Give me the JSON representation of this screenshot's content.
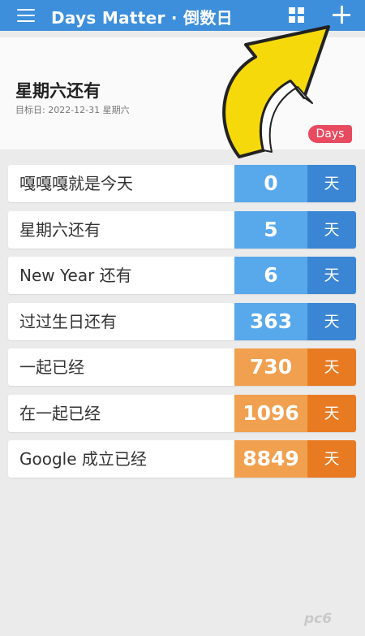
{
  "appbar": {
    "title": "Days Matter · 倒数日",
    "menu_icon": "hamburger-menu-icon",
    "grid_icon": "grid-view-icon",
    "add_icon": "plus-icon",
    "color": "#3d8fdc"
  },
  "header": {
    "event_title": "星期六还有",
    "target_date": "目标日: 2022-12-31 星期六",
    "badge": "Days",
    "badge_color": "#e84a5f"
  },
  "events": [
    {
      "name": "嘎嘎嘎就是今天",
      "days": "0",
      "unit": "天",
      "type": "countdown"
    },
    {
      "name": "星期六还有",
      "days": "5",
      "unit": "天",
      "type": "countdown"
    },
    {
      "name": "New Year 还有",
      "days": "6",
      "unit": "天",
      "type": "countdown"
    },
    {
      "name": "过过生日还有",
      "days": "363",
      "unit": "天",
      "type": "countdown"
    },
    {
      "name": "一起已经",
      "days": "730",
      "unit": "天",
      "type": "countup"
    },
    {
      "name": "在一起已经",
      "days": "1096",
      "unit": "天",
      "type": "countup"
    },
    {
      "name": "Google 成立已经",
      "days": "8849",
      "unit": "天",
      "type": "countup"
    }
  ],
  "colors": {
    "countdown_number": "#58a8ec",
    "countdown_unit": "#3a85d4",
    "countup_number": "#f0a04e",
    "countup_unit": "#e87a22"
  },
  "annotation": {
    "icon": "pointing-arrow-icon",
    "color": "#f5d90a"
  },
  "watermark": "pc6"
}
